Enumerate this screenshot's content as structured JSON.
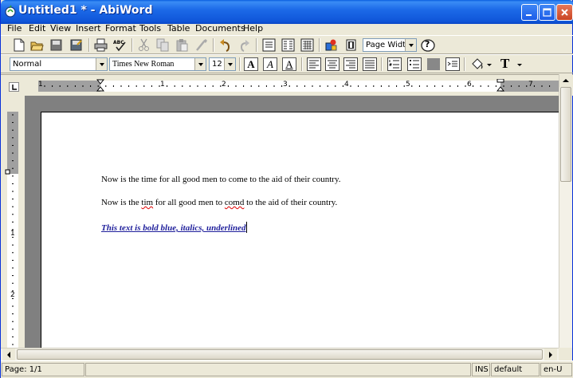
{
  "window": {
    "title": "Untitled1 * - AbiWord",
    "title_color": "#ffffff",
    "titlebar_color": "#0f55d8",
    "buttons": [
      "minimize-icon",
      "maximize-icon",
      "close-icon"
    ]
  },
  "menu": [
    "File",
    "Edit",
    "View",
    "Insert",
    "Format",
    "Tools",
    "Table",
    "Documents",
    "Help"
  ],
  "toolbar_standard": {
    "icons": [
      "new-document-icon",
      "open-folder-icon",
      "save-icon",
      "save-as-icon",
      "print-icon",
      "spellcheck-icon",
      "cut-icon",
      "copy-icon",
      "paste-icon",
      "format-painter-icon",
      "undo-icon",
      "redo-icon",
      "table-icon",
      "columns-icon",
      "grid-icon",
      "insert-image-icon",
      "insert-frame-icon",
      "help-icon"
    ],
    "zoom": "Page Width",
    "help_label": "?"
  },
  "toolbar_format": {
    "style": "Normal",
    "font": "Times New Roman",
    "size": "12",
    "bold_label": "A",
    "italic_label": "A",
    "underline_label": "A",
    "icons": [
      "align-left-icon",
      "align-center-icon",
      "align-right-icon",
      "justify-icon",
      "numbered-list-icon",
      "bulleted-list-icon",
      "decrease-indent-icon",
      "increase-indent-icon",
      "highlight-color-icon",
      "text-color-icon"
    ],
    "text_color_label": "T"
  },
  "ruler": {
    "labels": [
      "1",
      "1",
      "2",
      "3",
      "4",
      "5",
      "6",
      "7"
    ],
    "vertical_labels": [
      "1",
      "2"
    ]
  },
  "document": {
    "paragraphs": [
      {
        "pre": "Now is the time for all good men to come to the aid of their country."
      },
      {
        "pre": "Now is the ",
        "err1": "tim",
        "mid": " for all good men to ",
        "err2": "comd",
        "post": " to the aid of their country."
      },
      {
        "pre": "This text is bold blue, italics, underlined",
        "color": "#1e1e9b"
      }
    ]
  },
  "status": {
    "page": "Page: 1/1",
    "mode": "INS",
    "lang_style": "default",
    "locale": "en-U"
  }
}
